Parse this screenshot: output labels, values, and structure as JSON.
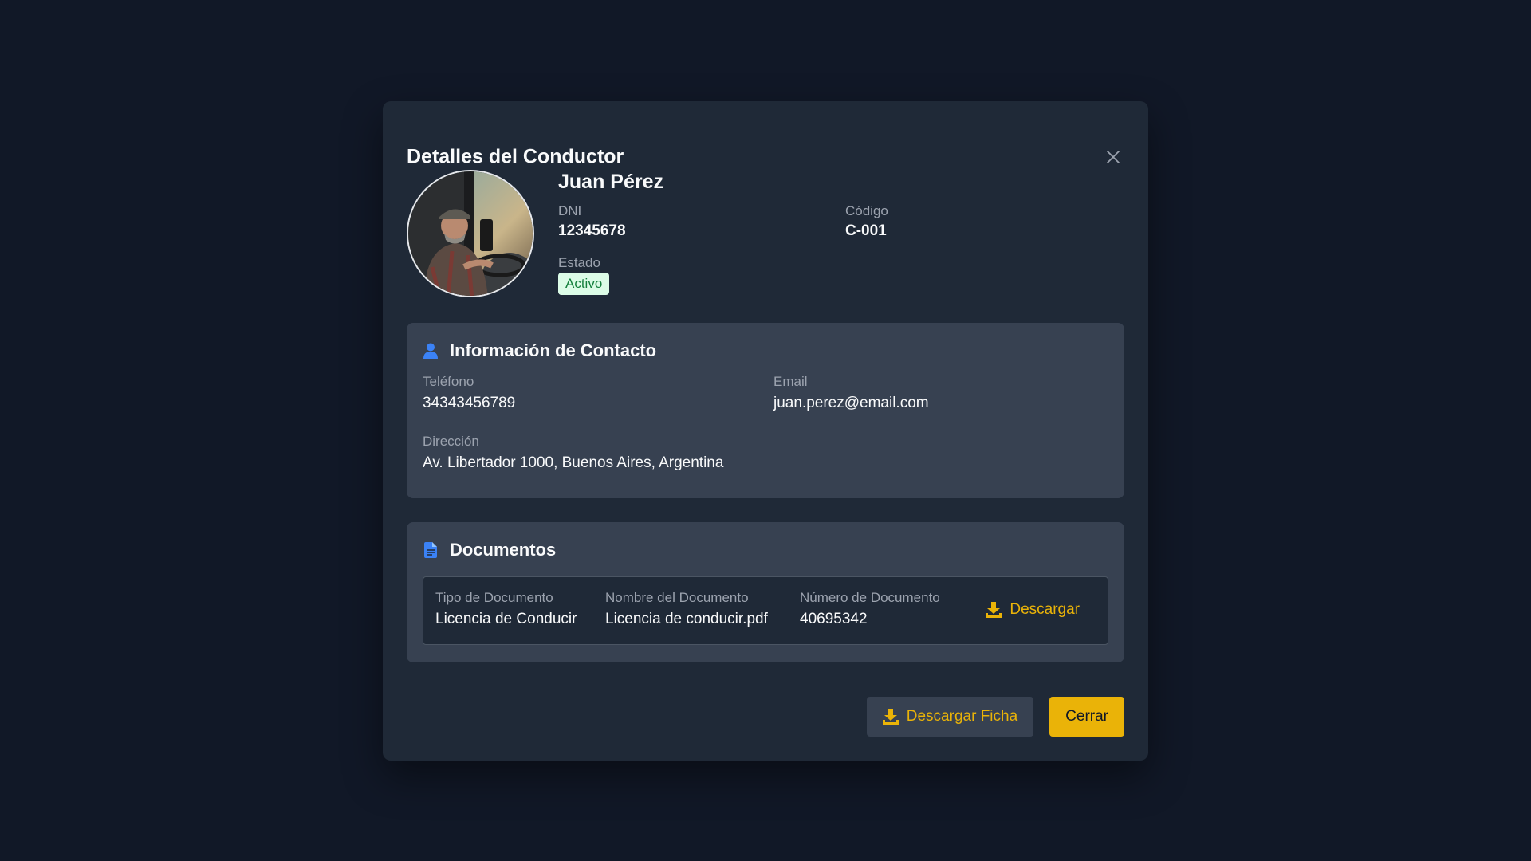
{
  "modal": {
    "title": "Detalles del Conductor",
    "close_icon": "close-icon"
  },
  "driver": {
    "name": "Juan Pérez",
    "dni_label": "DNI",
    "dni": "12345678",
    "code_label": "Código",
    "code": "C-001",
    "status_label": "Estado",
    "status": "Activo"
  },
  "contact": {
    "title": "Información de Contacto",
    "icon": "user-icon",
    "phone_label": "Teléfono",
    "phone": "34343456789",
    "email_label": "Email",
    "email": "juan.perez@email.com",
    "address_label": "Dirección",
    "address": "Av. Libertador 1000, Buenos Aires, Argentina"
  },
  "documents": {
    "title": "Documentos",
    "icon": "document-icon",
    "columns": [
      "Tipo de Documento",
      "Nombre del Documento",
      "Número de Documento"
    ],
    "rows": [
      {
        "type": "Licencia de Conducir",
        "name": "Licencia de conducir.pdf",
        "number": "40695342",
        "download_label": "Descargar"
      }
    ]
  },
  "footer": {
    "download_sheet_label": "Descargar Ficha",
    "close_label": "Cerrar"
  },
  "colors": {
    "background": "#111827",
    "modal": "#1f2937",
    "section": "#374151",
    "accent": "#eab308",
    "icon_blue": "#3b82f6",
    "badge_bg": "#dcfce7",
    "badge_text": "#15803d"
  }
}
